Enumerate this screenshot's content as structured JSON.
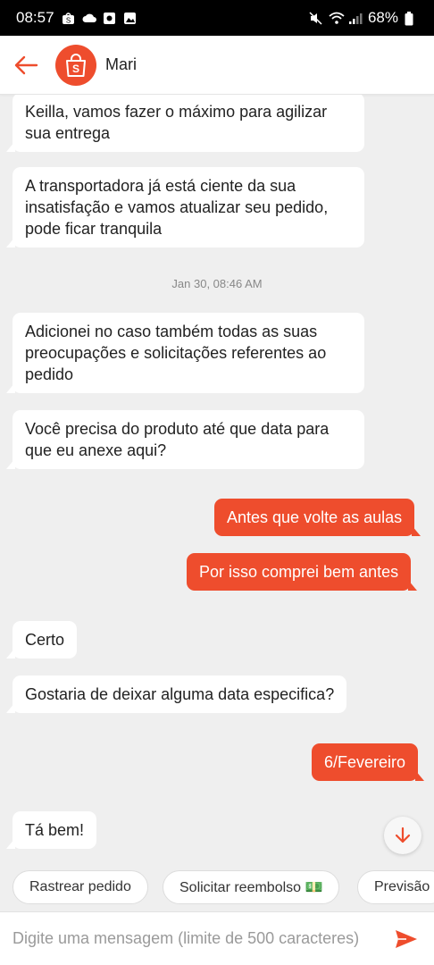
{
  "status_bar": {
    "time": "08:57",
    "battery": "68%"
  },
  "header": {
    "contact_name": "Mari"
  },
  "messages": [
    {
      "from": "agent",
      "text": "Keilla, vamos fazer o máximo para agilizar sua entrega"
    },
    {
      "from": "agent",
      "text": "A transportadora já está ciente da sua insatisfação e vamos atualizar seu pedido, pode ficar tranquila"
    },
    {
      "from": "agent",
      "text": "Adicionei no caso também todas as suas preocupações e solicitações referentes ao pedido"
    },
    {
      "from": "agent",
      "text": "Você precisa do produto até que data para que eu anexe aqui?"
    },
    {
      "from": "user",
      "text": "Antes que volte as aulas"
    },
    {
      "from": "user",
      "text": "Por isso comprei bem antes"
    },
    {
      "from": "agent",
      "text": "Certo"
    },
    {
      "from": "agent",
      "text": "Gostaria de deixar alguma data especifica?"
    },
    {
      "from": "user",
      "text": "6/Fevereiro"
    },
    {
      "from": "agent",
      "text": "Tá bem!"
    }
  ],
  "timestamps": [
    {
      "text": "Jan 30, 08:46 AM"
    }
  ],
  "quick_replies": [
    {
      "label": "Rastrear pedido"
    },
    {
      "label": "Solicitar reembolso 💵"
    },
    {
      "label": "Previsão"
    }
  ],
  "input": {
    "placeholder": "Digite uma mensagem (limite de 500 caracteres)"
  },
  "colors": {
    "accent": "#ee4d2d",
    "chat_bg": "#efefef",
    "bubble_in": "#ffffff"
  }
}
